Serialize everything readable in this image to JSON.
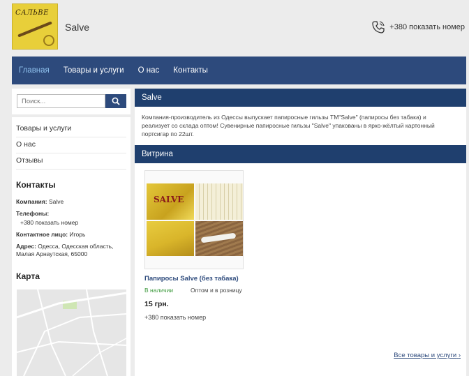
{
  "header": {
    "logo_text": "САЛЬВЕ",
    "company_name": "Salve",
    "phone": "+380 показать номер"
  },
  "nav": {
    "items": [
      {
        "label": "Главная",
        "active": true
      },
      {
        "label": "Товары и услуги"
      },
      {
        "label": "О нас"
      },
      {
        "label": "Контакты"
      }
    ]
  },
  "sidebar": {
    "search_placeholder": "Поиск...",
    "links": [
      "Товары и услуги",
      "О нас",
      "Отзывы"
    ],
    "contacts_title": "Контакты",
    "company_label": "Компания:",
    "company_value": "Salve",
    "phones_label": "Телефоны:",
    "phones_value": "+380 показать номер",
    "person_label": "Контактное лицо:",
    "person_value": "Игорь",
    "address_label": "Адрес:",
    "address_value": "Одесса, Одесская область, Малая Арнаутская, 65000",
    "map_title": "Карта"
  },
  "main": {
    "title": "Salve",
    "description": "Компания-производитель из Одессы выпускает папиросные гильзы ТМ\"Salve\" (папиросы без табака) и реализует со склада оптом! Сувенирные папиросные гильзы \"Salve\" упакованы в ярко-жёлтый картонный портсигар по 22шт.",
    "showcase_title": "Витрина",
    "product": {
      "photo_label": "SALVE",
      "name": "Папиросы Salve (без табака)",
      "availability": "В наличии",
      "sale_type": "Оптом и в розницу",
      "price": "15 грн.",
      "phone": "+380 показать номер"
    },
    "all_link": "Все товары и услуги"
  },
  "colors": {
    "nav": "#2d4a7c",
    "bar": "#1f3f6e",
    "active_nav": "#8fc1ee",
    "in_stock": "#3d9a3d"
  }
}
